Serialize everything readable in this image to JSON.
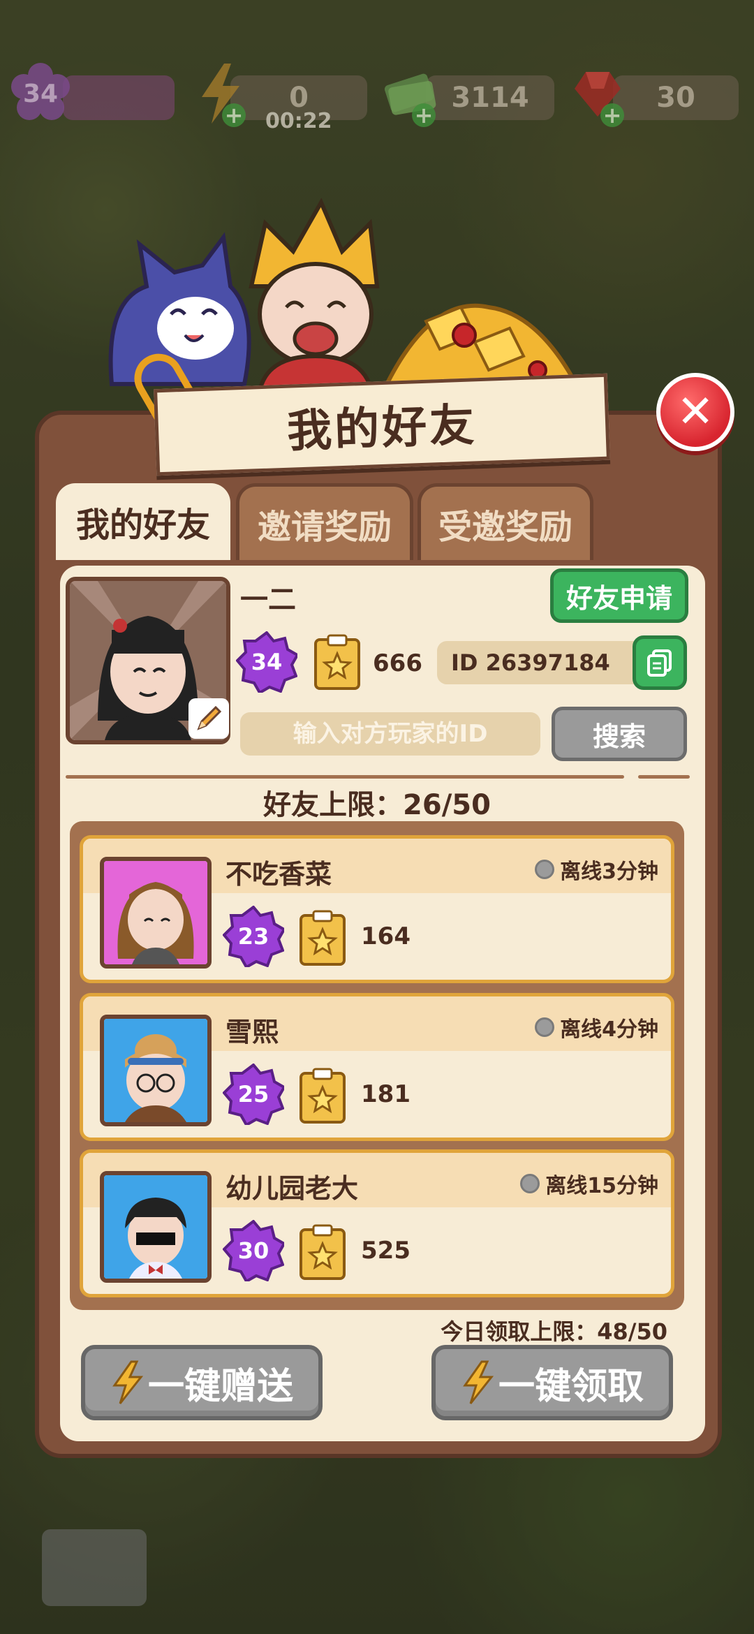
{
  "topbar": {
    "level": "34",
    "energy": "0",
    "energy_timer": "00:22",
    "cash": "3114",
    "gems": "30"
  },
  "dialog": {
    "title": "我的好友",
    "tabs": [
      "我的好友",
      "邀请奖励",
      "受邀奖励"
    ],
    "friend_request_label": "好友申请",
    "profile": {
      "name": "一二",
      "level": "34",
      "score": "666",
      "id_text": "ID 26397184"
    },
    "search": {
      "placeholder": "输入对方玩家的ID",
      "button_label": "搜索"
    },
    "friend_limit_text": "好友上限：26/50",
    "friends": [
      {
        "name": "不吃香菜",
        "level": "23",
        "score": "164",
        "status": "离线3分钟"
      },
      {
        "name": "雪熙",
        "level": "25",
        "score": "181",
        "status": "离线4分钟"
      },
      {
        "name": "幼儿园老大",
        "level": "30",
        "score": "525",
        "status": "离线15分钟"
      }
    ],
    "daily_limit_text": "今日领取上限：48/50",
    "send_all_label": "一键赠送",
    "claim_all_label": "一键领取"
  },
  "colors": {
    "panel_brown": "#80513b",
    "panel_cream": "#f7ecd6",
    "green_button": "#3cb45e",
    "gray_button": "#9a9a9a",
    "close_red": "#d8252f",
    "level_purple": "#9a3fd6",
    "card_border": "#e0a43a"
  },
  "icons": [
    "flower-level-icon",
    "lightning-icon",
    "cash-icon",
    "ruby-icon",
    "pencil-icon",
    "copy-icon",
    "clipboard-star-icon",
    "close-icon",
    "offline-dot-icon"
  ]
}
